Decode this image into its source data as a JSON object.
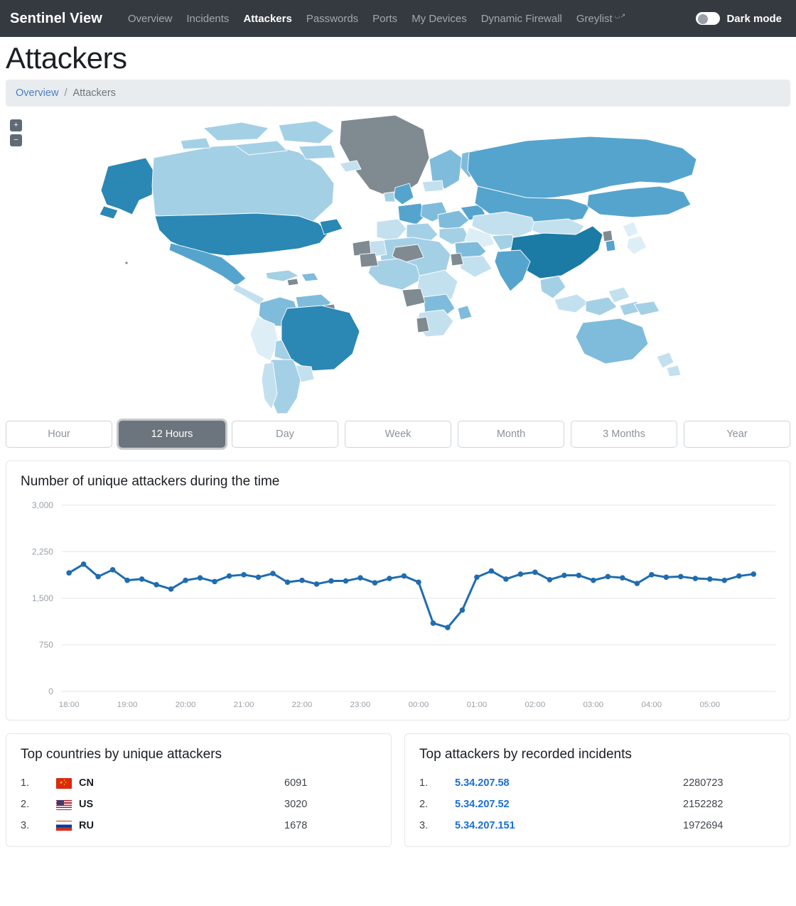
{
  "navbar": {
    "brand": "Sentinel View",
    "links": [
      {
        "label": "Overview",
        "active": false
      },
      {
        "label": "Incidents",
        "active": false
      },
      {
        "label": "Attackers",
        "active": true
      },
      {
        "label": "Passwords",
        "active": false
      },
      {
        "label": "Ports",
        "active": false
      },
      {
        "label": "My Devices",
        "active": false
      },
      {
        "label": "Dynamic Firewall",
        "active": false
      },
      {
        "label": "Greylist",
        "active": false,
        "external": true
      }
    ],
    "dark_mode_label": "Dark mode",
    "dark_mode_on": false,
    "background_color": "#343a40"
  },
  "page": {
    "title": "Attackers",
    "breadcrumb": {
      "parent": "Overview",
      "separator": "/",
      "current": "Attackers"
    }
  },
  "map": {
    "zoom_in_label": "+",
    "zoom_out_label": "−",
    "no_data_color": "#808a91",
    "scale_colors": [
      "#deeef7",
      "#c3e0ef",
      "#a4d0e6",
      "#7fbcdb",
      "#55a4cd",
      "#2b87b4",
      "#1b7ba5"
    ]
  },
  "range_tabs": [
    {
      "label": "Hour",
      "active": false
    },
    {
      "label": "12 Hours",
      "active": true
    },
    {
      "label": "Day",
      "active": false
    },
    {
      "label": "Week",
      "active": false
    },
    {
      "label": "Month",
      "active": false
    },
    {
      "label": "3 Months",
      "active": false
    },
    {
      "label": "Year",
      "active": false
    }
  ],
  "chart_card": {
    "title": "Number of unique attackers during the time"
  },
  "chart_data": {
    "type": "line",
    "title": "Number of unique attackers during the time",
    "xlabel": "",
    "ylabel": "",
    "ylim": [
      0,
      3000
    ],
    "yticks": [
      0,
      750,
      1500,
      2250,
      3000
    ],
    "ytick_labels": [
      "0",
      "750",
      "1,500",
      "2,250",
      "3,000"
    ],
    "xtick_labels": [
      "18:00",
      "19:00",
      "20:00",
      "21:00",
      "22:00",
      "23:00",
      "00:00",
      "01:00",
      "02:00",
      "03:00",
      "04:00",
      "05:00"
    ],
    "grid": true,
    "legend": false,
    "series_color": "#1f6cb0",
    "x": [
      "18:00",
      "18:15",
      "18:30",
      "18:45",
      "19:00",
      "19:15",
      "19:30",
      "19:45",
      "20:00",
      "20:15",
      "20:30",
      "20:45",
      "21:00",
      "21:15",
      "21:30",
      "21:45",
      "22:00",
      "22:15",
      "22:30",
      "22:45",
      "23:00",
      "23:15",
      "23:30",
      "23:45",
      "00:00",
      "00:15",
      "00:30",
      "00:45",
      "01:00",
      "01:15",
      "01:30",
      "01:45",
      "02:00",
      "02:15",
      "02:30",
      "02:45",
      "03:00",
      "03:15",
      "03:30",
      "03:45",
      "04:00",
      "04:15",
      "04:30",
      "04:45",
      "05:00",
      "05:15",
      "05:30",
      "05:45"
    ],
    "values": [
      1910,
      2050,
      1850,
      1960,
      1790,
      1810,
      1720,
      1650,
      1790,
      1830,
      1770,
      1860,
      1880,
      1840,
      1900,
      1760,
      1790,
      1730,
      1780,
      1780,
      1830,
      1750,
      1820,
      1860,
      1760,
      1100,
      1030,
      1310,
      1840,
      1940,
      1810,
      1890,
      1920,
      1800,
      1870,
      1870,
      1790,
      1850,
      1830,
      1740,
      1880,
      1840,
      1850,
      1820,
      1810,
      1790,
      1860,
      1890
    ]
  },
  "top_countries": {
    "title": "Top countries by unique attackers",
    "rows": [
      {
        "rank": "1.",
        "flag": "flag-cn",
        "code": "CN",
        "value": "6091"
      },
      {
        "rank": "2.",
        "flag": "flag-us",
        "code": "US",
        "value": "3020"
      },
      {
        "rank": "3.",
        "flag": "flag-ru",
        "code": "RU",
        "value": "1678"
      }
    ]
  },
  "top_attackers": {
    "title": "Top attackers by recorded incidents",
    "rows": [
      {
        "rank": "1.",
        "ip": "5.34.207.58",
        "value": "2280723"
      },
      {
        "rank": "2.",
        "ip": "5.34.207.52",
        "value": "2152282"
      },
      {
        "rank": "3.",
        "ip": "5.34.207.151",
        "value": "1972694"
      }
    ]
  }
}
